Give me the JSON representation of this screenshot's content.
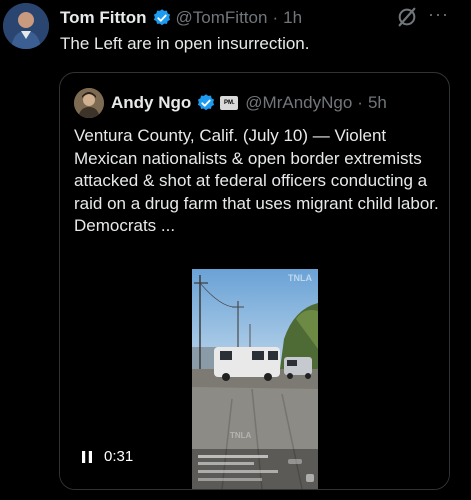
{
  "post": {
    "author_name": "Tom Fitton",
    "handle": "@TomFitton",
    "separator": "·",
    "time": "1h",
    "text": "The Left are in open insurrection.",
    "more_label": "···"
  },
  "quote": {
    "author_name": "Andy Ngo",
    "badge": "PM.",
    "handle": "@MrAndyNgo",
    "separator": "·",
    "time": "5h",
    "text": "Ventura County, Calif. (July 10) — Violent Mexican nationalists & open border extremists attacked & shot at federal officers conducting a raid on a drug farm that uses migrant child labor. Democrats ...",
    "video": {
      "duration": "0:31",
      "watermark_top": "TNLA",
      "watermark_mid": "TNLA"
    }
  },
  "colors": {
    "background": "#000000",
    "text_primary": "#e7e9ea",
    "text_secondary": "#71767b",
    "verified_blue": "#1d9bf0",
    "border": "#2f3336"
  }
}
